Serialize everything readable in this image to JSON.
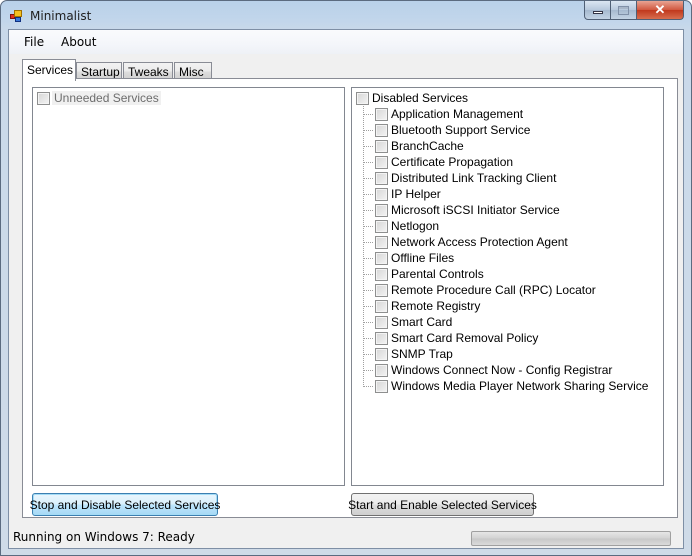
{
  "window": {
    "title": "Minimalist",
    "controls": {
      "minimize": "minimize",
      "maximize": "maximize",
      "close": "✕"
    }
  },
  "menu": [
    "File",
    "About"
  ],
  "tabs": [
    {
      "label": "Services",
      "active": true
    },
    {
      "label": "Startup",
      "active": false
    },
    {
      "label": "Tweaks",
      "active": false
    },
    {
      "label": "Misc",
      "active": false
    }
  ],
  "left_panel": {
    "root": {
      "label": "Unneeded Services",
      "checked": false,
      "enabled": false
    },
    "button": "Stop and Disable Selected Services"
  },
  "right_panel": {
    "root": {
      "label": "Disabled Services",
      "checked": false
    },
    "items": [
      "Application Management",
      "Bluetooth Support Service",
      "BranchCache",
      "Certificate Propagation",
      "Distributed Link Tracking Client",
      "IP Helper",
      "Microsoft iSCSI Initiator Service",
      "Netlogon",
      "Network Access Protection Agent",
      "Offline Files",
      "Parental Controls",
      "Remote Procedure Call (RPC) Locator",
      "Remote Registry",
      "Smart Card",
      "Smart Card Removal Policy",
      "SNMP Trap",
      "Windows Connect Now - Config Registrar",
      "Windows Media Player Network Sharing Service"
    ],
    "button": "Start and Enable Selected Services"
  },
  "status": {
    "text": "Running on Windows 7: Ready",
    "progress": 0
  }
}
